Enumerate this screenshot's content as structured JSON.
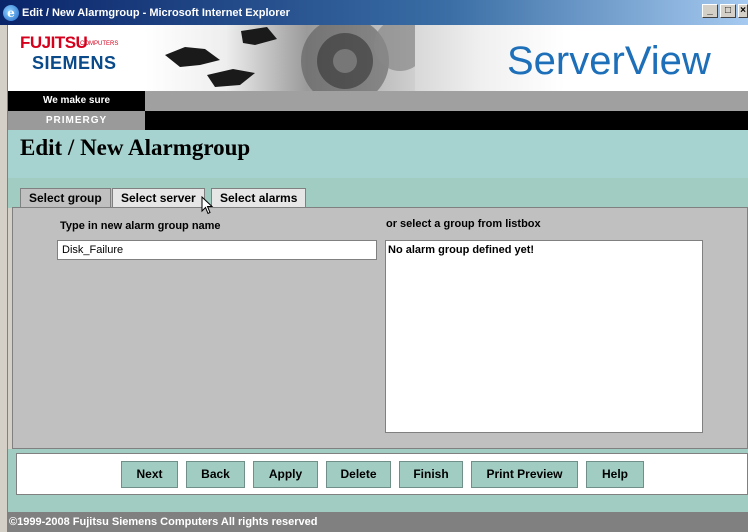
{
  "window": {
    "title": "Edit / New Alarmgroup - Microsoft Internet Explorer",
    "app_icon": "ie-icon",
    "controls": [
      "minimize",
      "maximize",
      "close"
    ]
  },
  "banner": {
    "brand_top": "FUJITSU",
    "brand_sub": "COMPUTERS",
    "brand_bottom": "SIEMENS",
    "product": "ServerView",
    "slogan": "We make sure",
    "line": "PRIMERGY"
  },
  "page": {
    "title": "Edit / New Alarmgroup"
  },
  "tabs": [
    {
      "label": "Select group",
      "active": true
    },
    {
      "label": "Select server",
      "active": false
    },
    {
      "label": "Select alarms",
      "active": false
    }
  ],
  "form": {
    "name_label": "Type in new alarm group name",
    "name_value": "Disk_Failure",
    "list_label": "or select a group from listbox",
    "list_empty": "No alarm group defined yet!"
  },
  "buttons": {
    "next": "Next",
    "back": "Back",
    "apply": "Apply",
    "delete": "Delete",
    "finish": "Finish",
    "print_preview": "Print Preview",
    "help": "Help"
  },
  "footer": {
    "copyright": "©1999-2008  Fujitsu Siemens Computers  All rights reserved"
  },
  "colors": {
    "accent": "#a0ccc2",
    "header": "#a6d3cf",
    "brand_red": "#d6001c",
    "brand_blue": "#1c6fb8"
  }
}
